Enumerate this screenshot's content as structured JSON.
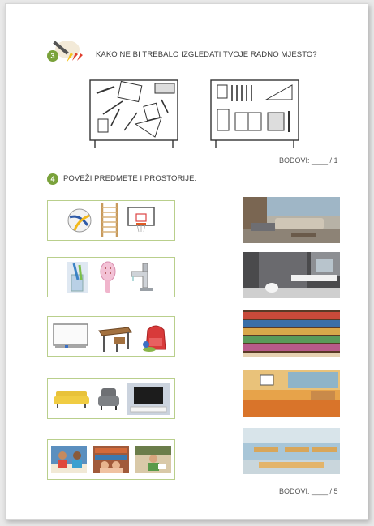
{
  "task3": {
    "number": "3",
    "question": "KAKO NE BI TREBALO IZGLEDATI TVOJE RADNO MJESTO?",
    "score": "BODOVI: ____ / 1",
    "icon": "pencil-crayons-icon"
  },
  "task4": {
    "number": "4",
    "question": "POVEŽI PREDMETE I PROSTORIJE.",
    "score": "BODOVI: ____ / 5",
    "object_groups": [
      {
        "items": [
          "volleyball",
          "wall-bars",
          "basketball-hoop"
        ]
      },
      {
        "items": [
          "toothbrush-in-glass",
          "hairbrush",
          "faucet"
        ]
      },
      {
        "items": [
          "whiteboard",
          "school-desk",
          "school-backpack"
        ]
      },
      {
        "items": [
          "yellow-sofa",
          "grey-armchair",
          "tv-stand"
        ]
      },
      {
        "items": [
          "children-reading-photo",
          "library-children-photo",
          "child-reading-photo"
        ]
      }
    ],
    "rooms": [
      "living-room",
      "bathroom",
      "library",
      "gym",
      "classroom"
    ]
  },
  "colors": {
    "accent_green": "#7aa23b",
    "box_border": "#b9cf8c"
  }
}
